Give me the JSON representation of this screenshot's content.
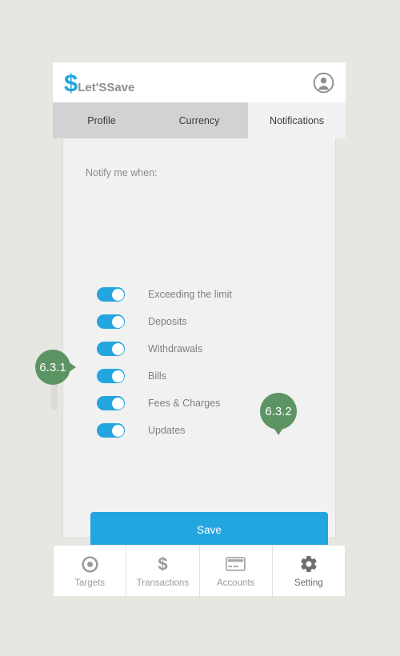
{
  "header": {
    "logo_symbol": "$",
    "logo_text": "Let'SSave",
    "avatar_icon": "user-avatar-icon"
  },
  "tabs": [
    {
      "label": "Profile",
      "active": false
    },
    {
      "label": "Currency",
      "active": false
    },
    {
      "label": "Notifications",
      "active": true
    }
  ],
  "content": {
    "section_label": "Notify me when:",
    "toggles": [
      {
        "label": "Exceeding the limit",
        "on": true
      },
      {
        "label": "Deposits",
        "on": true
      },
      {
        "label": "Withdrawals",
        "on": true
      },
      {
        "label": "Bills",
        "on": true
      },
      {
        "label": "Fees & Charges",
        "on": true
      },
      {
        "label": "Updates",
        "on": true
      }
    ],
    "save_label": "Save"
  },
  "bottom_nav": [
    {
      "label": "Targets",
      "icon": "target-icon",
      "active": false
    },
    {
      "label": "Transactions",
      "icon": "dollar-icon",
      "active": false
    },
    {
      "label": "Accounts",
      "icon": "credit-card-icon",
      "active": false
    },
    {
      "label": "Setting",
      "icon": "gear-icon",
      "active": true
    }
  ],
  "annotations": [
    {
      "label": "6.3.1",
      "points_to": "updates-toggle"
    },
    {
      "label": "6.3.2",
      "points_to": "save-button"
    }
  ],
  "colors": {
    "accent": "#23a5e0",
    "annotation": "#5d9464",
    "page_background": "#e5e7e0",
    "tab_strip": "#d2d2d2",
    "card": "#f1f1f1"
  }
}
